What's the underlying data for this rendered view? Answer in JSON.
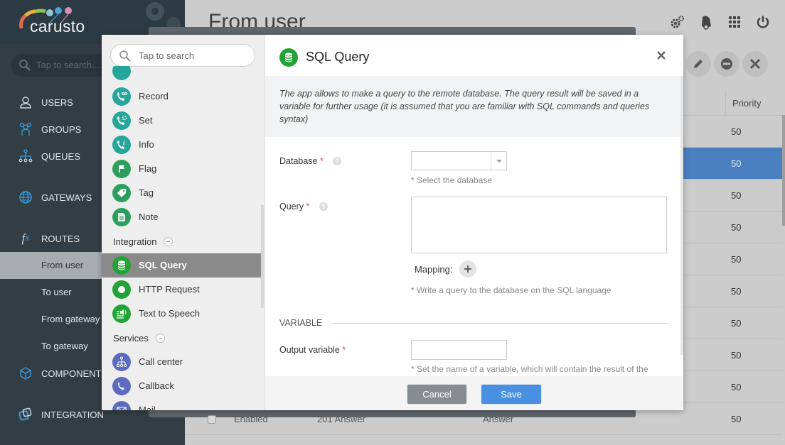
{
  "app": {
    "logo_text": "carusto",
    "search_placeholder": "Tap to search..."
  },
  "sidebar": {
    "items": [
      {
        "label": "Users",
        "icon": "user-icon"
      },
      {
        "label": "Groups",
        "icon": "groups-icon"
      },
      {
        "label": "Queues",
        "icon": "queues-icon"
      },
      {
        "label": "Gateways",
        "icon": "globe-icon"
      },
      {
        "label": "Routes",
        "icon": "fx-icon"
      },
      {
        "label": "Components",
        "icon": "cube-icon"
      },
      {
        "label": "Integration",
        "icon": "integration-icon"
      }
    ],
    "route_subitems": [
      {
        "label": "From user",
        "active": true
      },
      {
        "label": "To user",
        "active": false
      },
      {
        "label": "From gateway",
        "active": false
      },
      {
        "label": "To gateway",
        "active": false
      }
    ]
  },
  "main": {
    "page_title": "From user",
    "top_icons": [
      "settings-icon",
      "notifications-bell-icon",
      "apps-grid-icon",
      "power-icon"
    ],
    "actions": [
      "edit-icon",
      "disable-icon",
      "delete-icon"
    ],
    "table": {
      "visible_header": "Priority",
      "priorities": [
        "50",
        "50",
        "50",
        "50",
        "50",
        "50",
        "50",
        "50",
        "50",
        "50"
      ],
      "selected_index": 1,
      "last_row": {
        "status": "Enabled",
        "name": "201 Answer",
        "type": "Answer",
        "priority": "50"
      }
    }
  },
  "palette": {
    "search_placeholder": "Tap to search",
    "items": [
      {
        "label": "Record",
        "icon": "phone-record-icon",
        "color": "#26a69a"
      },
      {
        "label": "Set",
        "icon": "phone-gear-icon",
        "color": "#26a69a"
      },
      {
        "label": "Info",
        "icon": "phone-info-icon",
        "color": "#26a69a"
      },
      {
        "label": "Flag",
        "icon": "flag-icon",
        "color": "#2e9e5e"
      },
      {
        "label": "Tag",
        "icon": "tag-icon",
        "color": "#2e9e5e"
      },
      {
        "label": "Note",
        "icon": "note-icon",
        "color": "#2e9e5e"
      }
    ],
    "groups": [
      {
        "label": "Integration",
        "items": [
          {
            "label": "SQL Query",
            "icon": "database-icon",
            "color": "#21a336",
            "active": true
          },
          {
            "label": "HTTP Request",
            "icon": "http-icon",
            "color": "#21a336"
          },
          {
            "label": "Text to Speech",
            "icon": "speech-icon",
            "color": "#21a336"
          }
        ]
      },
      {
        "label": "Services",
        "items": [
          {
            "label": "Call center",
            "icon": "call-center-icon",
            "color": "#5c6bc0"
          },
          {
            "label": "Callback",
            "icon": "callback-phone-icon",
            "color": "#5c6bc0"
          },
          {
            "label": "Mail",
            "icon": "mail-icon",
            "color": "#5c6bc0"
          }
        ]
      }
    ]
  },
  "dialog": {
    "title": "SQL Query",
    "description": "The app allows to make a query to the remote database. The query result will be saved in a variable for further usage (it is assumed that you are familiar with SQL commands and queries syntax)",
    "fields": {
      "database": {
        "label": "Database",
        "required_mark": "*",
        "value": "",
        "hint": "* Select the database"
      },
      "query": {
        "label": "Query",
        "required_mark": "*",
        "value": "",
        "mapping_label": "Mapping:",
        "hint": "* Write a query to the database on the SQL language"
      },
      "section_title": "VARIABLE",
      "output_variable": {
        "label": "Output variable",
        "required_mark": "*",
        "value": "",
        "hint": "* Set the name of a variable, which will contain the result of the"
      }
    },
    "buttons": {
      "cancel": "Cancel",
      "save": "Save"
    },
    "help_glyph": "?"
  }
}
